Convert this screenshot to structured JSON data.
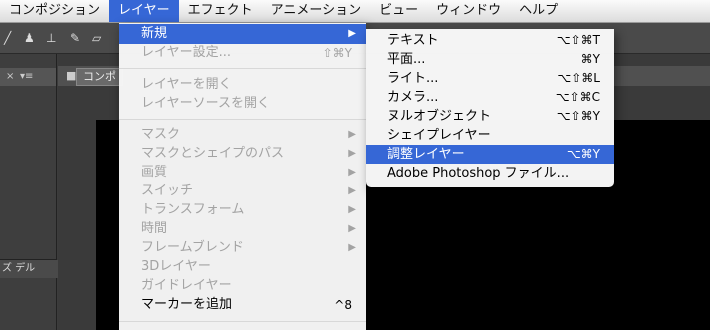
{
  "menubar": {
    "items": [
      "コンポジション",
      "レイヤー",
      "エフェクト",
      "アニメーション",
      "ビュー",
      "ウィンドウ",
      "ヘルプ"
    ],
    "active_index": 1
  },
  "background": {
    "comp_tab": "コンポ",
    "columns_label": "ズ デル"
  },
  "layer_menu": {
    "items": [
      {
        "label": "新規",
        "shortcut": "",
        "submenu": true,
        "disabled": false,
        "highlighted": true
      },
      {
        "label": "レイヤー設定...",
        "shortcut": "⇧⌘Y",
        "submenu": false,
        "disabled": true,
        "highlighted": false
      },
      {
        "label": "レイヤーを開く",
        "shortcut": "",
        "submenu": false,
        "disabled": true,
        "highlighted": false
      },
      {
        "label": "レイヤーソースを開く",
        "shortcut": "",
        "submenu": false,
        "disabled": true,
        "highlighted": false
      },
      {
        "label": "マスク",
        "shortcut": "",
        "submenu": true,
        "disabled": true,
        "highlighted": false
      },
      {
        "label": "マスクとシェイプのパス",
        "shortcut": "",
        "submenu": true,
        "disabled": true,
        "highlighted": false
      },
      {
        "label": "画質",
        "shortcut": "",
        "submenu": true,
        "disabled": true,
        "highlighted": false
      },
      {
        "label": "スイッチ",
        "shortcut": "",
        "submenu": true,
        "disabled": true,
        "highlighted": false
      },
      {
        "label": "トランスフォーム",
        "shortcut": "",
        "submenu": true,
        "disabled": true,
        "highlighted": false
      },
      {
        "label": "時間",
        "shortcut": "",
        "submenu": true,
        "disabled": true,
        "highlighted": false
      },
      {
        "label": "フレームブレンド",
        "shortcut": "",
        "submenu": true,
        "disabled": true,
        "highlighted": false
      },
      {
        "label": "3Dレイヤー",
        "shortcut": "",
        "submenu": false,
        "disabled": true,
        "highlighted": false
      },
      {
        "label": "ガイドレイヤー",
        "shortcut": "",
        "submenu": false,
        "disabled": true,
        "highlighted": false
      },
      {
        "label": "マーカーを追加",
        "shortcut": "^8",
        "submenu": false,
        "disabled": false,
        "highlighted": false
      }
    ]
  },
  "new_submenu": {
    "items": [
      {
        "label": "テキスト",
        "shortcut": "⌥⇧⌘T",
        "highlighted": false
      },
      {
        "label": "平面...",
        "shortcut": "⌘Y",
        "highlighted": false
      },
      {
        "label": "ライト...",
        "shortcut": "⌥⇧⌘L",
        "highlighted": false
      },
      {
        "label": "カメラ...",
        "shortcut": "⌥⇧⌘C",
        "highlighted": false
      },
      {
        "label": "ヌルオブジェクト",
        "shortcut": "⌥⇧⌘Y",
        "highlighted": false
      },
      {
        "label": "シェイプレイヤー",
        "shortcut": "",
        "highlighted": false
      },
      {
        "label": "調整レイヤー",
        "shortcut": "⌥⌘Y",
        "highlighted": true
      },
      {
        "label": "Adobe Photoshop ファイル...",
        "shortcut": "",
        "highlighted": false
      }
    ]
  },
  "colors": {
    "highlight": "#3667d6",
    "disabled_text": "#a3a3a3",
    "menu_background": "#f8f8f8"
  }
}
